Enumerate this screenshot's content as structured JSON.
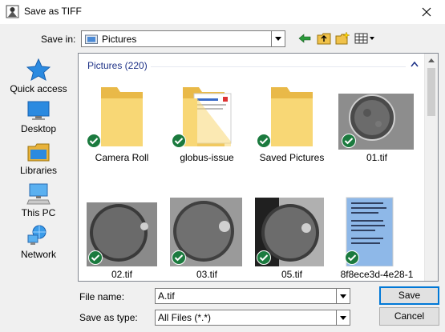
{
  "window": {
    "title": "Save as TIFF"
  },
  "toolbar": {
    "save_in_label": "Save in:",
    "save_in_value": "Pictures"
  },
  "places": [
    {
      "name": "quick-access",
      "label": "Quick access",
      "icon": "star-icon"
    },
    {
      "name": "desktop",
      "label": "Desktop",
      "icon": "desktop-icon"
    },
    {
      "name": "libraries",
      "label": "Libraries",
      "icon": "libraries-icon"
    },
    {
      "name": "this-pc",
      "label": "This PC",
      "icon": "computer-icon"
    },
    {
      "name": "network",
      "label": "Network",
      "icon": "network-icon"
    }
  ],
  "filelist": {
    "group_header": "Pictures (220)",
    "items": [
      {
        "label": "Camera Roll",
        "kind": "folder"
      },
      {
        "label": "globus-issue",
        "kind": "folder-doc"
      },
      {
        "label": "Saved Pictures",
        "kind": "folder"
      },
      {
        "label": "01.tif",
        "kind": "image"
      },
      {
        "label": "02.tif",
        "kind": "image"
      },
      {
        "label": "03.tif",
        "kind": "image"
      },
      {
        "label": "05.tif",
        "kind": "image"
      },
      {
        "label": "8f8ece3d-4e28-1",
        "kind": "document"
      }
    ]
  },
  "form": {
    "file_name_label": "File name:",
    "file_name_value": "A.tif",
    "save_type_label": "Save as type:",
    "save_type_value": "All Files (*.*)"
  },
  "buttons": {
    "save": "Save",
    "cancel": "Cancel"
  },
  "colors": {
    "accent": "#0078d7",
    "folder": "#f8d775",
    "check": "#1b7a3e"
  }
}
